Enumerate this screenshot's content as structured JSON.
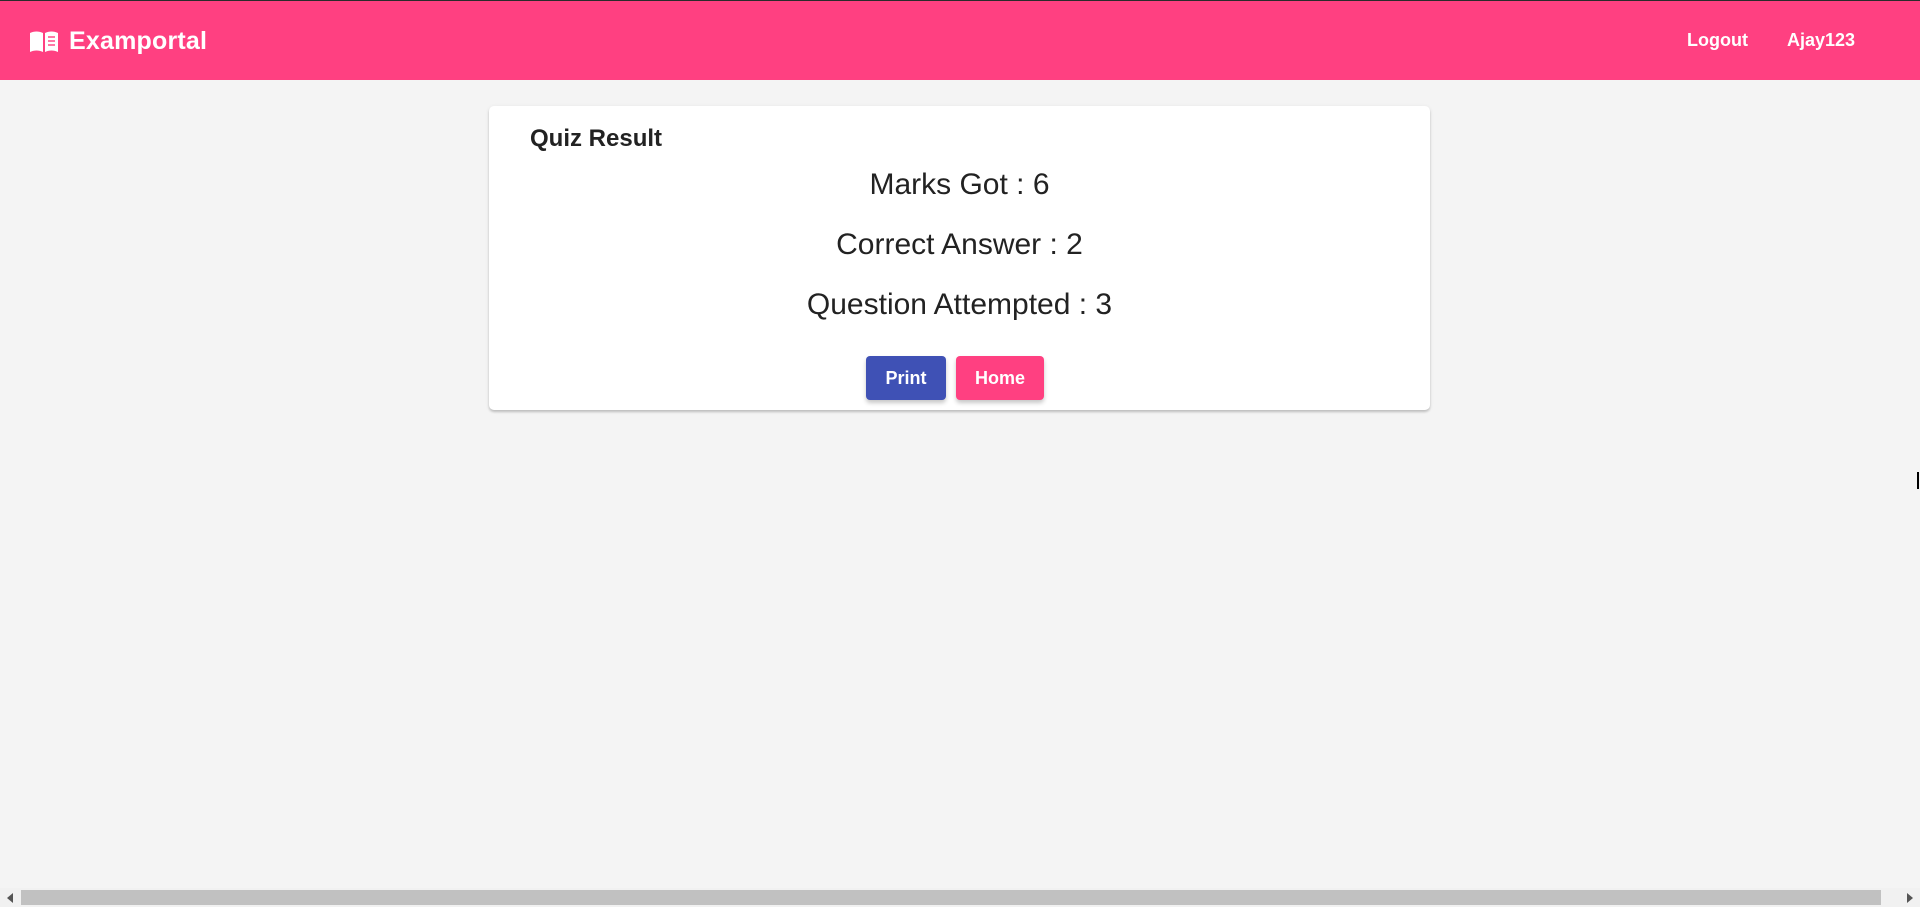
{
  "header": {
    "brand_icon": "book-open-icon",
    "brand_title": "Examportal",
    "nav": {
      "logout_label": "Logout",
      "username_label": "Ajay123"
    }
  },
  "result_card": {
    "title": "Quiz Result",
    "stats": {
      "marks_got": "Marks Got : 6",
      "correct_answer": "Correct Answer : 2",
      "question_attempted": "Question Attempted : 3"
    },
    "buttons": {
      "print_label": "Print",
      "home_label": "Home"
    }
  },
  "colors": {
    "header_bg": "#ff4081",
    "print_button": "#3f51b5",
    "home_button": "#ff4081",
    "page_bg": "#f4f4f4"
  }
}
